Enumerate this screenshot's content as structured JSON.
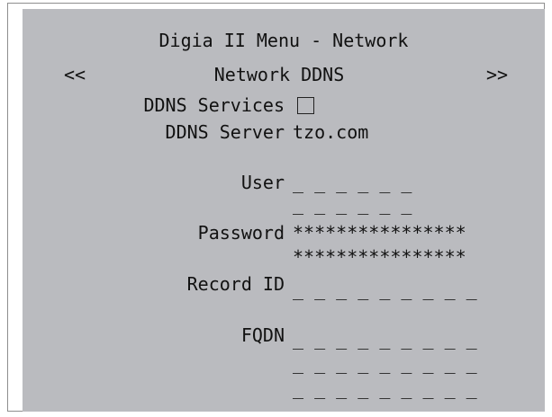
{
  "menu": {
    "title": "Digia II Menu - Network",
    "prev_label": "<<",
    "section_title": "Network DDNS",
    "next_label": ">>"
  },
  "fields": {
    "ddns_services": {
      "label": "DDNS Services",
      "checked": false
    },
    "ddns_server": {
      "label": "DDNS Server",
      "value": "tzo.com"
    },
    "user": {
      "label": "User",
      "line1": "_ _ _ _ _ _",
      "line2": "_ _ _ _ _ _"
    },
    "password": {
      "label": "Password",
      "line1": "****************",
      "line2": "****************"
    },
    "record_id": {
      "label": "Record ID",
      "line1": "_ _ _ _ _ _ _ _ _"
    },
    "fqdn": {
      "label": "FQDN",
      "line1": "_ _ _ _ _ _ _ _ _",
      "line2": "_ _ _ _ _ _ _ _ _",
      "line3": "_ _ _ _ _ _ _ _ _"
    }
  },
  "colors": {
    "panel_background": "#babbbf",
    "text": "#111111",
    "frame_border": "#8e8e8e"
  }
}
